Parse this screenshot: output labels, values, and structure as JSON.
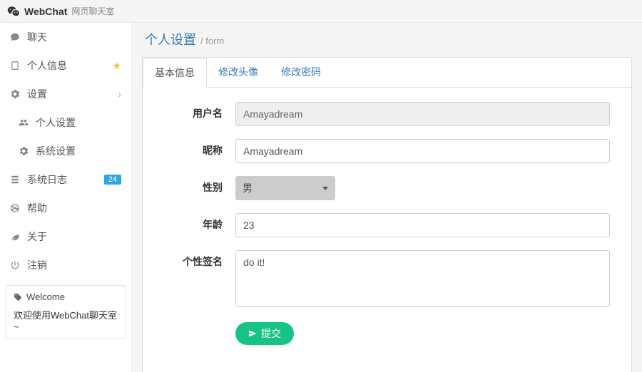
{
  "header": {
    "brand": "WebChat",
    "tagline": "网页聊天室"
  },
  "sidebar": {
    "items": [
      {
        "label": "聊天"
      },
      {
        "label": "个人信息"
      },
      {
        "label": "设置"
      },
      {
        "label": "个人设置"
      },
      {
        "label": "系统设置"
      },
      {
        "label": "系统日志",
        "badge": "24"
      },
      {
        "label": "帮助"
      },
      {
        "label": "关于"
      },
      {
        "label": "注销"
      }
    ],
    "welcome": {
      "title": "Welcome",
      "text": "欢迎使用WebChat聊天室~"
    }
  },
  "page": {
    "title": "个人设置",
    "sub": "/ form"
  },
  "tabs": [
    {
      "label": "基本信息"
    },
    {
      "label": "修改头像"
    },
    {
      "label": "修改密码"
    }
  ],
  "form": {
    "username": {
      "label": "用户名",
      "value": "Amayadream"
    },
    "nickname": {
      "label": "昵称",
      "value": "Amayadream"
    },
    "gender": {
      "label": "性别",
      "value": "男"
    },
    "age": {
      "label": "年龄",
      "value": "23"
    },
    "bio": {
      "label": "个性签名",
      "value": "do it!"
    },
    "submit": "提交"
  }
}
